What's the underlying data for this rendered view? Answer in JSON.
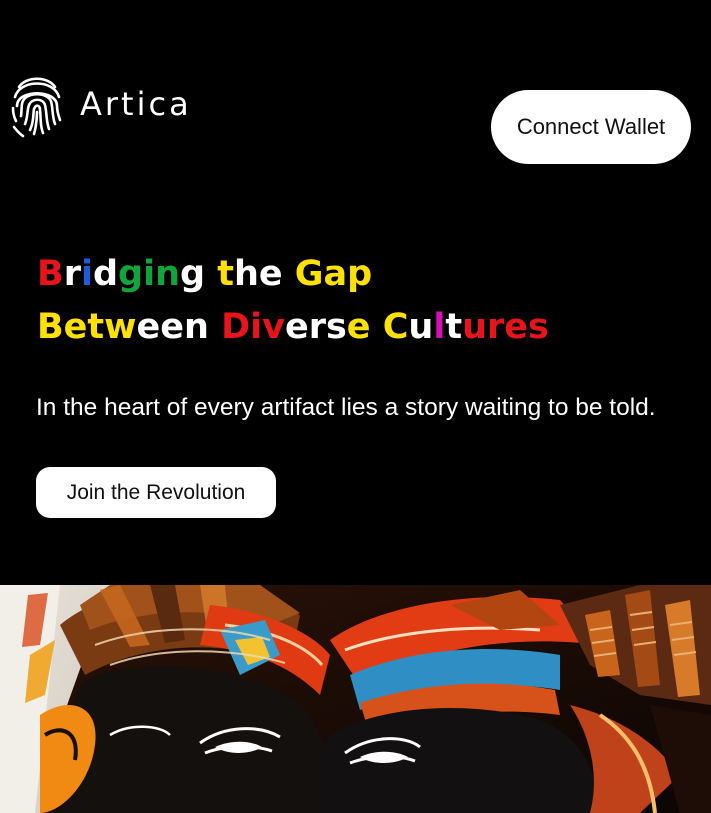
{
  "header": {
    "logo_text": "Artica",
    "connect_label": "Connect Wallet"
  },
  "hero": {
    "title_line1": [
      {
        "text": "B",
        "color": "#e8141b"
      },
      {
        "text": "r",
        "color": "#ffffff"
      },
      {
        "text": "i",
        "color": "#1e5bd6"
      },
      {
        "text": "d",
        "color": "#ffffff"
      },
      {
        "text": "gin",
        "color": "#10a53a"
      },
      {
        "text": "g ",
        "color": "#ffffff"
      },
      {
        "text": "t",
        "color": "#ffe100"
      },
      {
        "text": "he",
        "color": "#ffffff"
      },
      {
        "text": " Gap",
        "color": "#ffe100"
      }
    ],
    "title_line2": [
      {
        "text": "Betw",
        "color": "#ffe100"
      },
      {
        "text": "ee",
        "color": "#ffffff"
      },
      {
        "text": "n ",
        "color": "#ffffff"
      },
      {
        "text": "Div",
        "color": "#e8141b"
      },
      {
        "text": "e",
        "color": "#ffffff"
      },
      {
        "text": "rs",
        "color": "#ffffff"
      },
      {
        "text": "e ",
        "color": "#ffe100"
      },
      {
        "text": "C",
        "color": "#ffe100"
      },
      {
        "text": "u",
        "color": "#ffffff"
      },
      {
        "text": "l",
        "color": "#d60fb8"
      },
      {
        "text": "t",
        "color": "#ffffff"
      },
      {
        "text": "ures",
        "color": "#e8141b"
      }
    ],
    "subtitle": "In the heart of every artifact lies a story waiting to be told.",
    "cta_label": "Join the Revolution"
  },
  "artwork": {
    "alt": "abstract painting of two faces",
    "icon": "artwork-image"
  },
  "colors": {
    "background": "#000000",
    "button_bg": "#ffffff",
    "red": "#e8141b",
    "yellow": "#ffe100",
    "green": "#10a53a",
    "blue": "#1e5bd6",
    "magenta": "#d60fb8"
  }
}
